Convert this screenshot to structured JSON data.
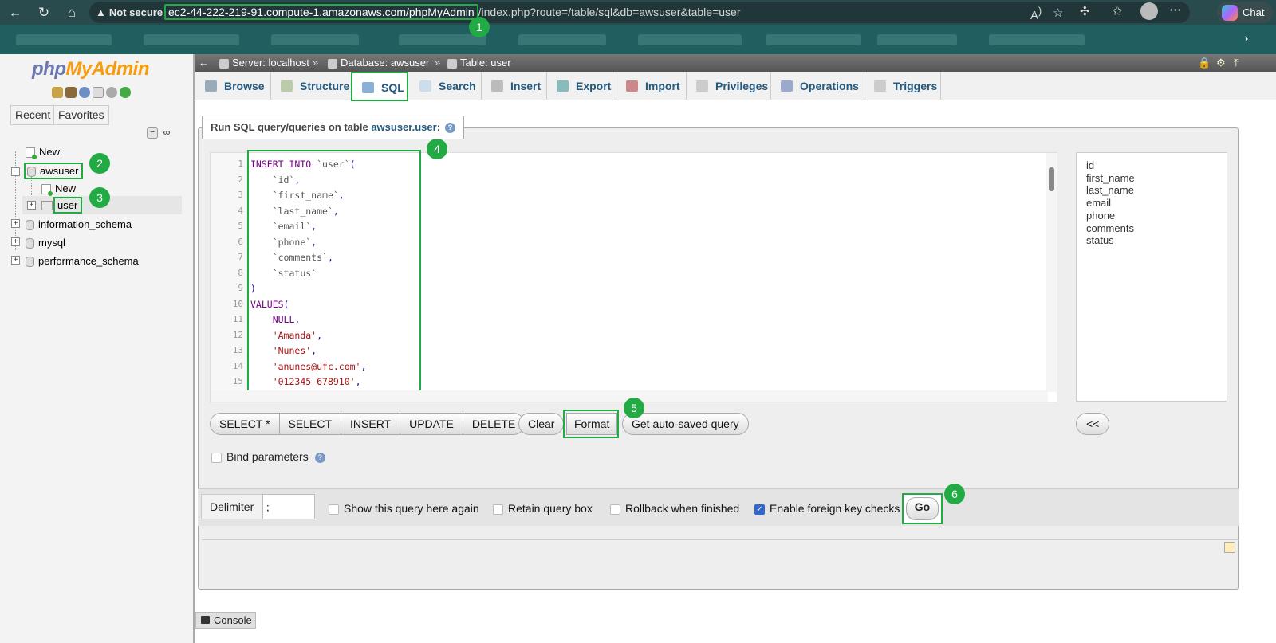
{
  "browser": {
    "not_secure": "Not secure",
    "url_host": "ec2-44-222-219-91.compute-1.amazonaws.com/phpMyAdmin",
    "url_path": "/index.php?route=/table/sql&db=awsuser&table=user",
    "chat_label": "Chat"
  },
  "sidebar": {
    "logo_php": "php",
    "logo_myadmin": "MyAdmin",
    "recent": "Recent",
    "favorites": "Favorites",
    "tree": {
      "new": "New",
      "db_awsuser": "awsuser",
      "awsuser_new": "New",
      "table_user": "user",
      "db_information_schema": "information_schema",
      "db_mysql": "mysql",
      "db_performance_schema": "performance_schema"
    }
  },
  "breadcrumb": {
    "server": "Server: localhost",
    "database": "Database: awsuser",
    "table": "Table: user",
    "sep": "»"
  },
  "tabs": [
    {
      "label": "Browse"
    },
    {
      "label": "Structure"
    },
    {
      "label": "SQL"
    },
    {
      "label": "Search"
    },
    {
      "label": "Insert"
    },
    {
      "label": "Export"
    },
    {
      "label": "Import"
    },
    {
      "label": "Privileges"
    },
    {
      "label": "Operations"
    },
    {
      "label": "Triggers"
    }
  ],
  "sql": {
    "legend_prefix": "Run SQL query/queries on table",
    "legend_table": "awsuser.user",
    "legend_suffix": ":",
    "line_numbers": [
      "1",
      "2",
      "3",
      "4",
      "5",
      "6",
      "7",
      "8",
      "9",
      "10",
      "11",
      "12",
      "13",
      "14",
      "15"
    ],
    "fields": [
      "id",
      "first_name",
      "last_name",
      "email",
      "phone",
      "comments",
      "status"
    ],
    "buttons": {
      "select_star": "SELECT *",
      "select": "SELECT",
      "insert": "INSERT",
      "update": "UPDATE",
      "delete": "DELETE",
      "clear": "Clear",
      "format": "Format",
      "get_autosaved": "Get auto-saved query",
      "collapse": "<<"
    },
    "bind_parameters": "Bind parameters"
  },
  "options": {
    "delimiter_label": "Delimiter",
    "delimiter_value": ";",
    "show_query": "Show this query here again",
    "retain_box": "Retain query box",
    "rollback": "Rollback when finished",
    "foreign_keys": "Enable foreign key checks",
    "foreign_keys_checked": true,
    "go": "Go"
  },
  "console": "Console",
  "annotations": [
    "1",
    "2",
    "3",
    "4",
    "5",
    "6"
  ]
}
